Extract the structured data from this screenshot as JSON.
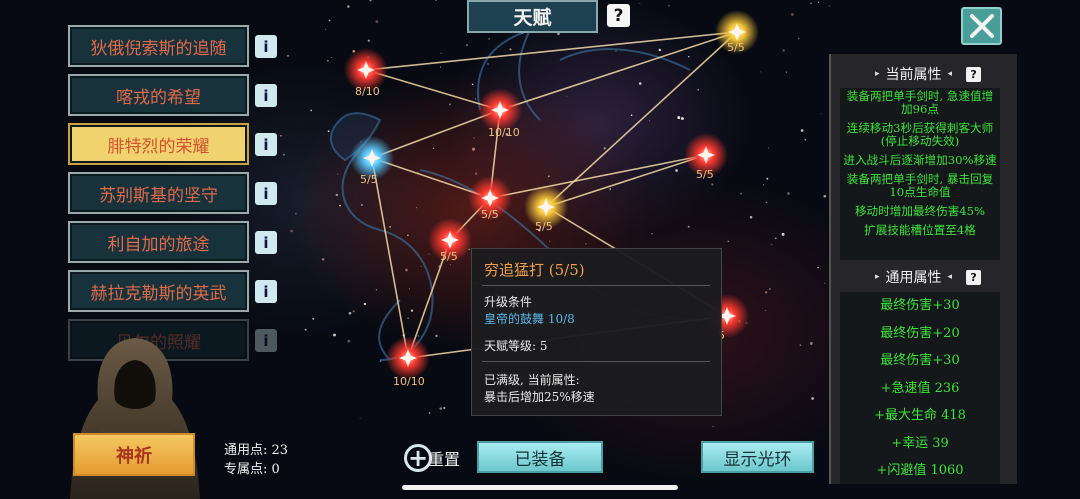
{
  "header": {
    "title": "天赋",
    "help_glyph": "?"
  },
  "talents": [
    {
      "label": "狄俄倪索斯的追随",
      "state": "normal"
    },
    {
      "label": "喀戎的希望",
      "state": "normal"
    },
    {
      "label": "腓特烈的荣耀",
      "state": "active"
    },
    {
      "label": "苏别斯基的坚守",
      "state": "normal"
    },
    {
      "label": "利自加的旅途",
      "state": "normal"
    },
    {
      "label": "赫拉克勒斯的英武",
      "state": "normal"
    },
    {
      "label": "贝尔的照耀",
      "state": "faded"
    }
  ],
  "info_glyph": "i",
  "nodes": [
    {
      "label": "5/5",
      "color": "#f6c43a"
    },
    {
      "label": "8/10",
      "color": "#ff3a30"
    },
    {
      "label": "10/10",
      "color": "#ff3a30"
    },
    {
      "label": "5/5",
      "color": "#ff3a30"
    },
    {
      "label": "5/5",
      "color": "#5ac8ff"
    },
    {
      "label": "5/5",
      "color": "#ff3a30"
    },
    {
      "label": "5/5",
      "color": "#f6c43a"
    },
    {
      "label": "5/5",
      "color": "#ff3a30"
    },
    {
      "label": "10/10",
      "color": "#ff3a30"
    },
    {
      "label": "5",
      "color": "#ff3a30"
    }
  ],
  "tooltip": {
    "title": "穷追猛打 (5/5)",
    "cond_label": "升级条件",
    "cond_value": "皇帝的鼓舞  10/8",
    "level_label": "天赋等级: 5",
    "maxed_label": "已满级, 当前属性:",
    "effect": "暴击后增加25%移速"
  },
  "current_attrs": {
    "title": "当前属性",
    "lines": [
      "装备两把单手剑时, 急速值增加96点",
      "连续移动3秒后获得刺客大师 (停止移动失效)",
      "进入战斗后逐渐增加30%移速",
      "装备两把单手剑时, 暴击回复10点生命值",
      "移动时增加最终伤害45%",
      "扩展技能槽位置至4格"
    ]
  },
  "general_attrs": {
    "title": "通用属性",
    "lines": [
      "最终伤害+30",
      "最终伤害+20",
      "最终伤害+30",
      "+急速值  236",
      "+最大生命  418",
      "+幸运  39",
      "+闪避值  1060"
    ]
  },
  "bottom": {
    "pray": "神祈",
    "general_points_label": "通用点: 23",
    "special_points_label": "专属点: 0",
    "reset": "重置",
    "equipped": "已装备",
    "show_halo": "显示光环"
  },
  "colors": {
    "accent_green": "#3ce23a",
    "accent_orange": "#f0a04a",
    "list_red": "#e06a4a",
    "teal": "#6cc8cc"
  }
}
